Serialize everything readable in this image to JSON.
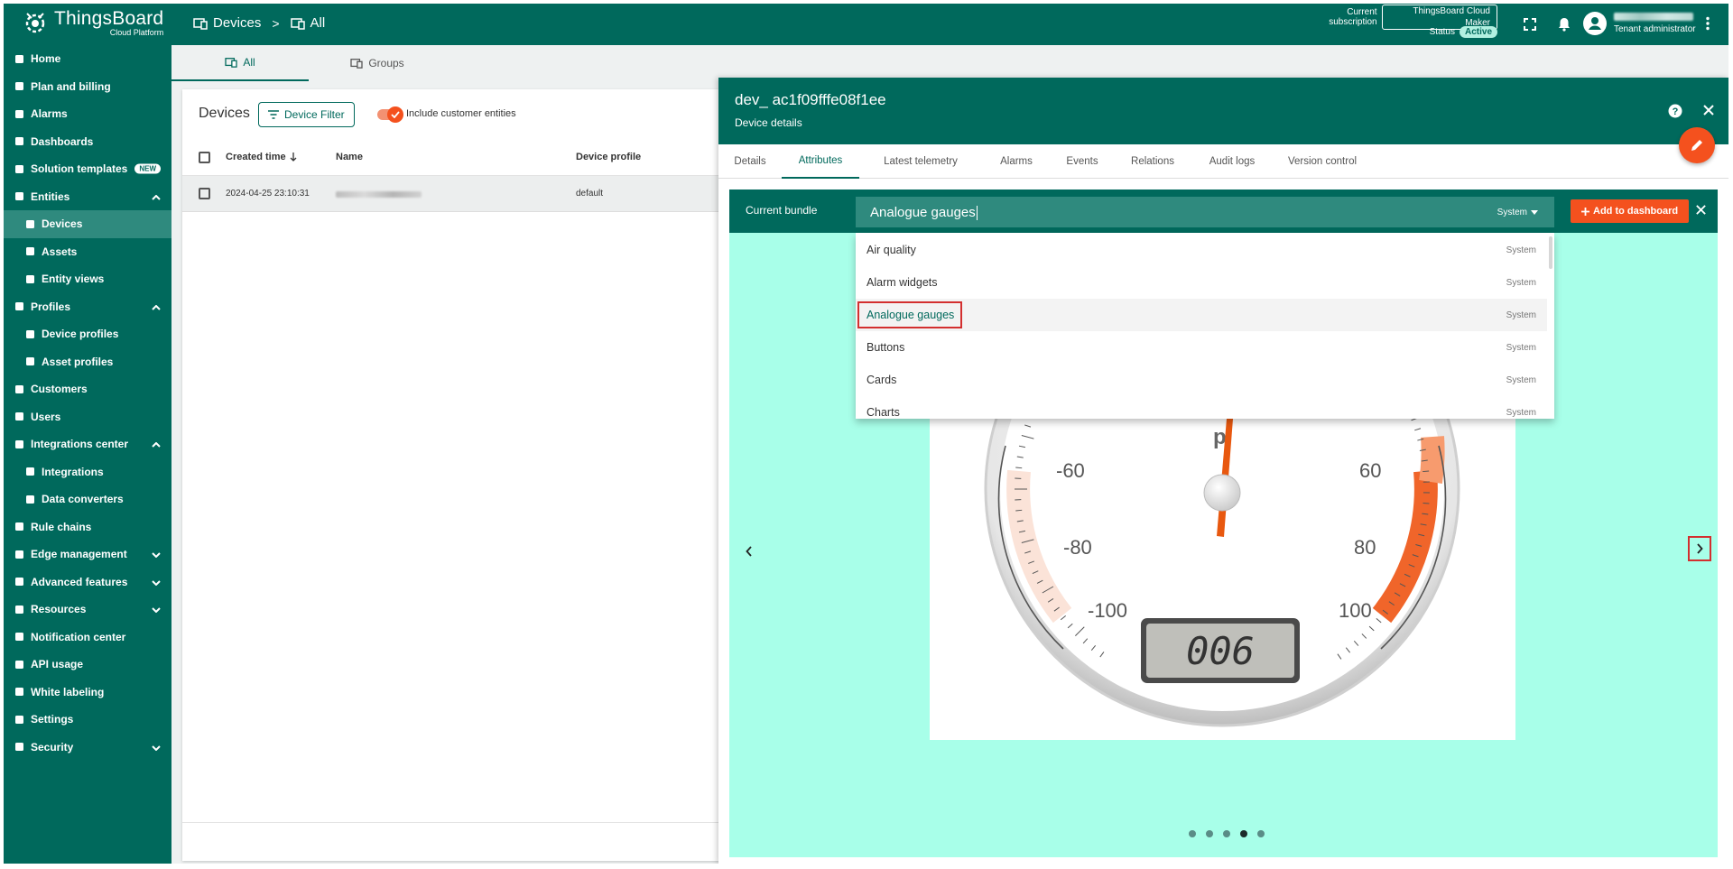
{
  "app": {
    "title": "ThingsBoard",
    "subtitle": "Cloud Platform"
  },
  "breadcrumb": [
    {
      "label": "Devices"
    },
    {
      "label": "All"
    }
  ],
  "subscription": {
    "label": "Current subscription",
    "plan": "ThingsBoard Cloud Maker",
    "status_label": "Status",
    "status": "Active"
  },
  "user": {
    "role": "Tenant administrator"
  },
  "sidebar": {
    "items": [
      {
        "label": "Home",
        "icon": "home-icon"
      },
      {
        "label": "Plan and billing",
        "icon": "billing-icon"
      },
      {
        "label": "Alarms",
        "icon": "alarm-icon"
      },
      {
        "label": "Dashboards",
        "icon": "dashboard-icon"
      },
      {
        "label": "Solution templates",
        "icon": "templates-icon",
        "badge": "NEW"
      },
      {
        "label": "Entities",
        "icon": "entities-icon"
      },
      {
        "label": "Devices",
        "icon": "devices-icon"
      },
      {
        "label": "Assets",
        "icon": "assets-icon"
      },
      {
        "label": "Entity views",
        "icon": "entity-views-icon"
      },
      {
        "label": "Profiles",
        "icon": "profiles-icon"
      },
      {
        "label": "Device profiles",
        "icon": "device-profiles-icon"
      },
      {
        "label": "Asset profiles",
        "icon": "asset-profiles-icon"
      },
      {
        "label": "Customers",
        "icon": "customers-icon"
      },
      {
        "label": "Users",
        "icon": "users-icon"
      },
      {
        "label": "Integrations center",
        "icon": "integrations-center-icon"
      },
      {
        "label": "Integrations",
        "icon": "integrations-icon"
      },
      {
        "label": "Data converters",
        "icon": "data-converters-icon"
      },
      {
        "label": "Rule chains",
        "icon": "rule-chains-icon"
      },
      {
        "label": "Edge management",
        "icon": "edge-icon"
      },
      {
        "label": "Advanced features",
        "icon": "advanced-icon"
      },
      {
        "label": "Resources",
        "icon": "resources-icon"
      },
      {
        "label": "Notification center",
        "icon": "notification-center-icon"
      },
      {
        "label": "API usage",
        "icon": "api-usage-icon"
      },
      {
        "label": "White labeling",
        "icon": "white-labeling-icon"
      },
      {
        "label": "Settings",
        "icon": "settings-icon"
      },
      {
        "label": "Security",
        "icon": "security-icon"
      }
    ]
  },
  "main_tabs": [
    {
      "label": "All"
    },
    {
      "label": "Groups"
    }
  ],
  "devices": {
    "title": "Devices",
    "filter_label": "Device Filter",
    "include_customer_label": "Include customer entities",
    "columns": [
      "Created time",
      "Name",
      "Device profile"
    ],
    "rows": [
      {
        "created": "2024-04-25 23:10:31",
        "profile": "default"
      }
    ]
  },
  "details": {
    "title": "dev_ ac1f09fffe08f1ee",
    "subtitle": "Device details",
    "tabs": [
      "Details",
      "Attributes",
      "Latest telemetry",
      "Alarms",
      "Events",
      "Relations",
      "Audit logs",
      "Version control"
    ],
    "bundle": {
      "label": "Current bundle",
      "value": "Analogue gauges",
      "scope": "System",
      "add_button": "Add to dashboard",
      "options": [
        {
          "label": "Air quality",
          "tag": "System"
        },
        {
          "label": "Alarm widgets",
          "tag": "System"
        },
        {
          "label": "Analogue gauges",
          "tag": "System"
        },
        {
          "label": "Buttons",
          "tag": "System"
        },
        {
          "label": "Cards",
          "tag": "System"
        },
        {
          "label": "Charts",
          "tag": "System"
        }
      ]
    },
    "gauge": {
      "unit": "p",
      "labels": [
        "-60",
        "-80",
        "-100",
        "60",
        "80",
        "100"
      ],
      "readout": "006"
    },
    "carousel": {
      "pages": 5,
      "active": 4
    }
  },
  "colors": {
    "primary": "#00695c",
    "accent": "#f4511e",
    "bundle_bg": "#a8ffe9",
    "highlight": "#d32f2f"
  }
}
